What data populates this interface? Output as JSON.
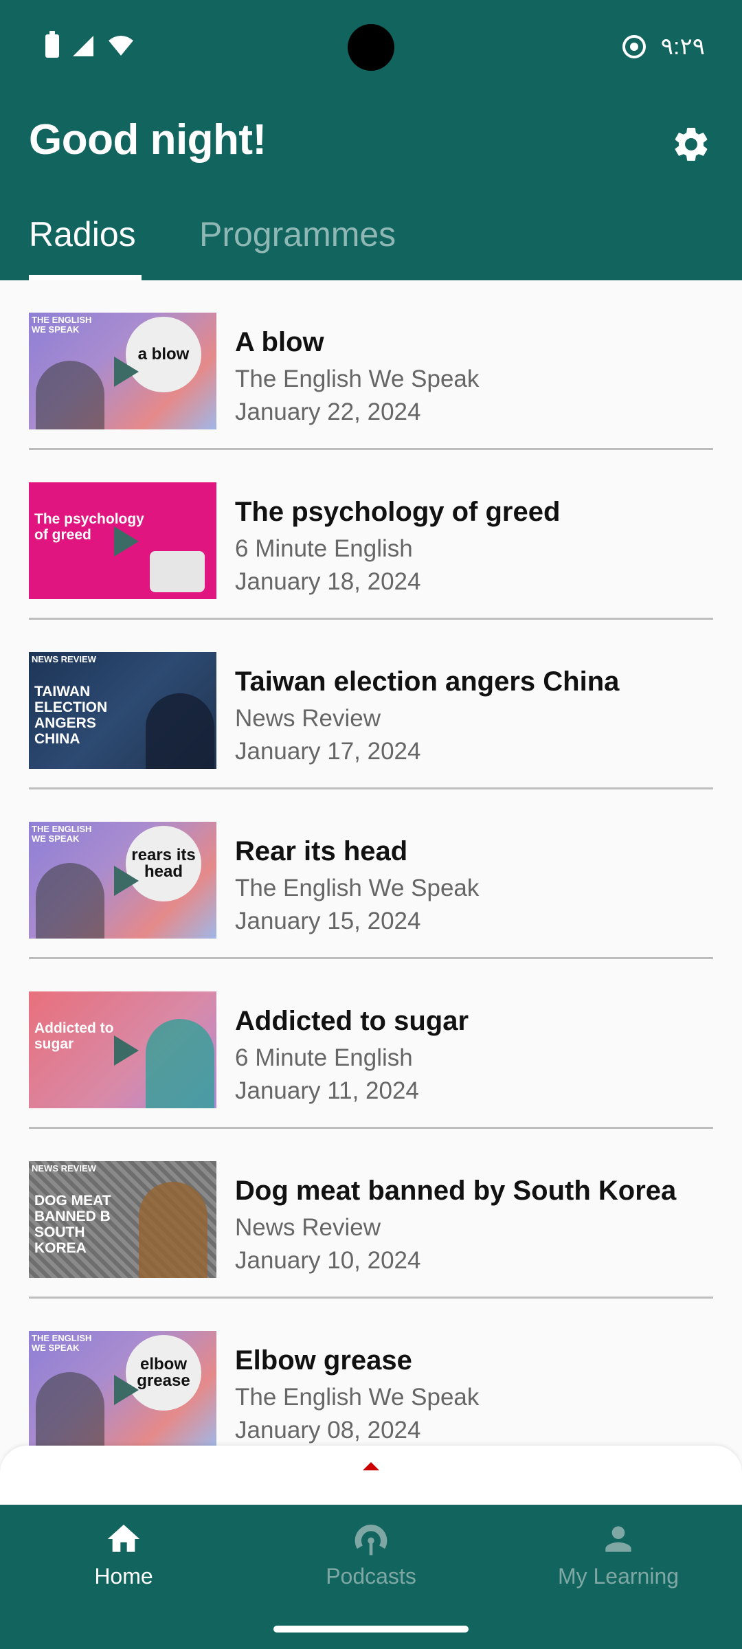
{
  "status_bar": {
    "time": "٩:٢٩"
  },
  "header": {
    "greeting": "Good night!"
  },
  "tabs": [
    {
      "label": "Radios",
      "selected": true
    },
    {
      "label": "Programmes",
      "selected": false
    }
  ],
  "episodes": [
    {
      "title": "A blow",
      "series": "The English We Speak",
      "date": "January 22, 2024",
      "thumb": {
        "kicker": "THE ENGLISH WE SPEAK",
        "text": "",
        "bubble": "a blow",
        "bg": "linear-gradient(135deg,#8e7fd6 0%,#a98ccf 40%,#e58a8a 75%,#9fb7e8 100%)"
      }
    },
    {
      "title": "The psychology of greed",
      "series": "6 Minute English",
      "date": "January 18, 2024",
      "thumb": {
        "kicker": "",
        "text": "The psychology of greed",
        "bubble": "",
        "bg": "#e0157f"
      }
    },
    {
      "title": "Taiwan election angers China",
      "series": "News Review",
      "date": "January 17, 2024",
      "thumb": {
        "kicker": "NEWS REVIEW",
        "text": "TAIWAN ELECTION ANGERS CHINA",
        "bubble": "",
        "bg": "linear-gradient(135deg,#1d3557 0%,#2d4a72 50%,#20344f 100%)"
      }
    },
    {
      "title": "Rear its head",
      "series": "The English We Speak",
      "date": "January 15, 2024",
      "thumb": {
        "kicker": "THE ENGLISH WE SPEAK",
        "text": "",
        "bubble": "rears its head",
        "bg": "linear-gradient(135deg,#8e7fd6 0%,#a98ccf 40%,#e58a8a 75%,#9fb7e8 100%)"
      }
    },
    {
      "title": "Addicted to sugar",
      "series": "6 Minute English",
      "date": "January 11, 2024",
      "thumb": {
        "kicker": "",
        "text": "Addicted to sugar",
        "bubble": "",
        "bg": "linear-gradient(135deg,#e8707c 0%,#d88aa8 60%,#b08ad8 100%)"
      }
    },
    {
      "title": "Dog meat banned by South Korea",
      "series": "News Review",
      "date": "January 10, 2024",
      "thumb": {
        "kicker": "NEWS REVIEW",
        "text": "DOG MEAT BANNED B SOUTH KOREA",
        "bubble": "",
        "bg": "linear-gradient(135deg,#7a7a7a 0%,#9a9a9a 50%,#6d6d6d 100%)"
      }
    },
    {
      "title": "Elbow grease",
      "series": "The English We Speak",
      "date": "January 08, 2024",
      "thumb": {
        "kicker": "THE ENGLISH WE SPEAK",
        "text": "",
        "bubble": "elbow grease",
        "bg": "linear-gradient(135deg,#8e7fd6 0%,#a98ccf 40%,#e58a8a 75%,#9fb7e8 100%)"
      }
    }
  ],
  "bottom_nav": [
    {
      "label": "Home",
      "icon": "home-icon",
      "selected": true
    },
    {
      "label": "Podcasts",
      "icon": "podcast-icon",
      "selected": false
    },
    {
      "label": "My Learning",
      "icon": "person-icon",
      "selected": false
    }
  ],
  "colors": {
    "primary": "#12645f",
    "selected_tab": "#ffffff",
    "unselected_tab": "#8fb8b5",
    "accent_red": "#cc0000"
  }
}
